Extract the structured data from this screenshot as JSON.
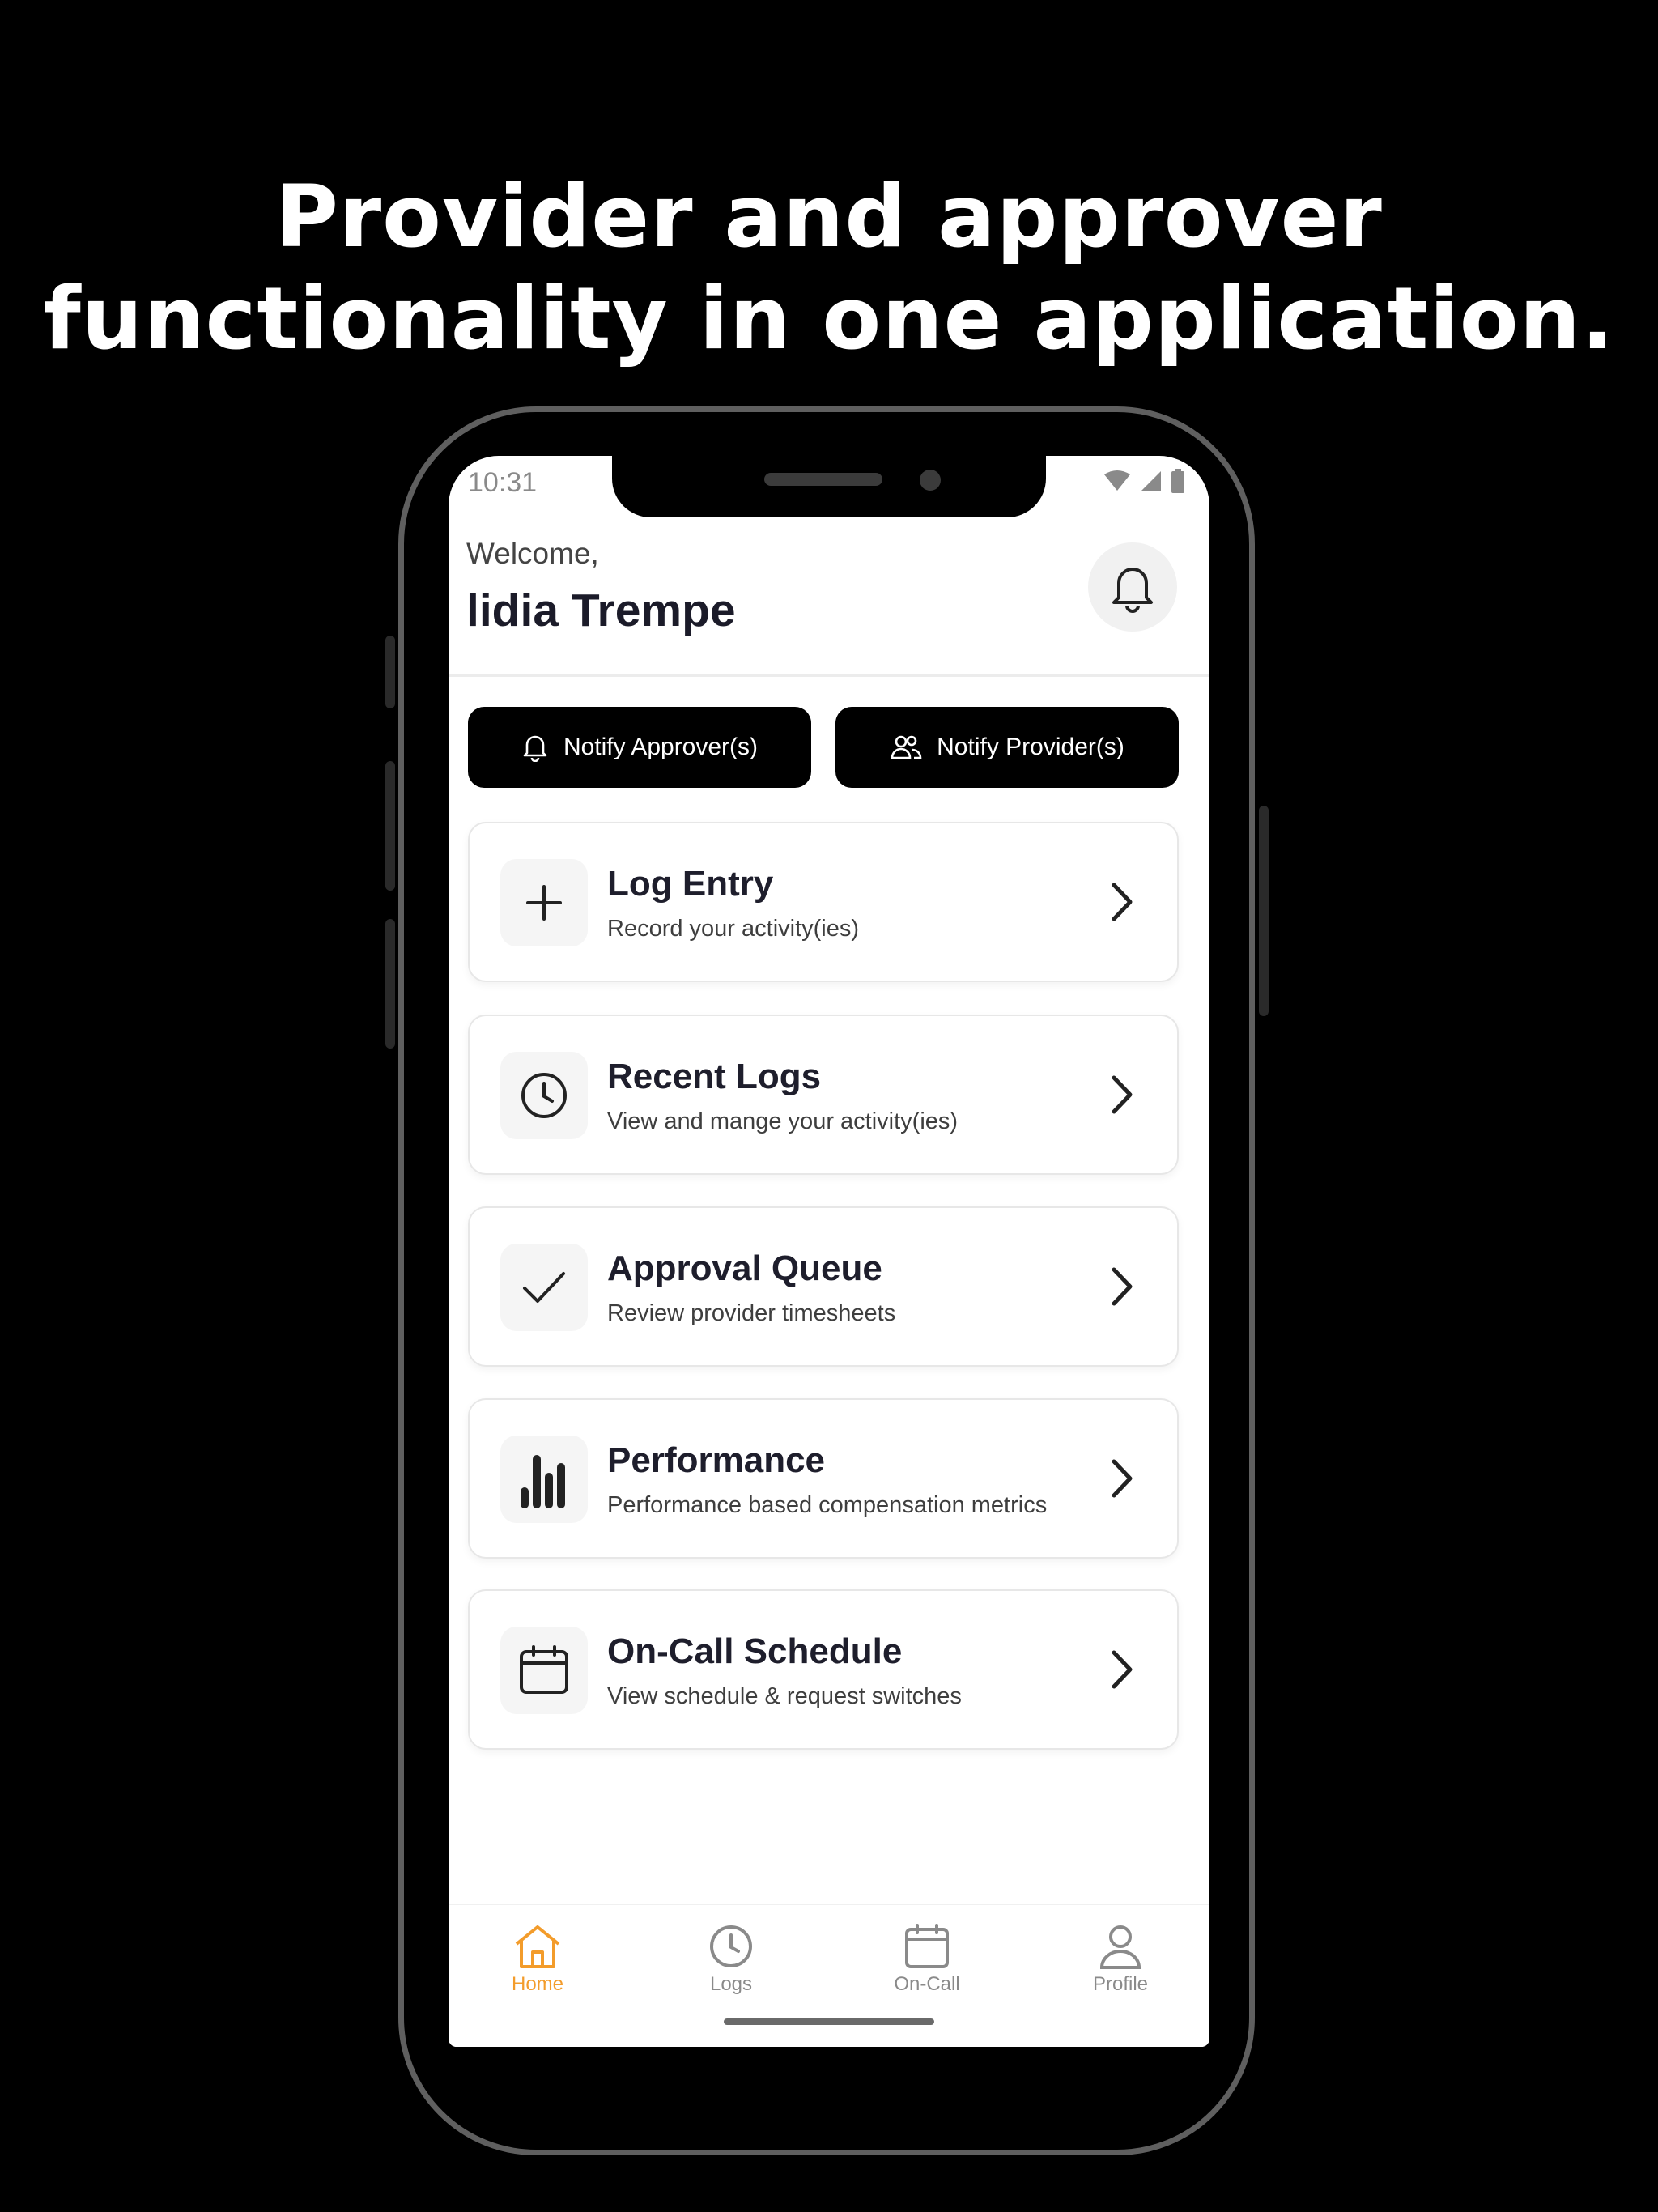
{
  "headline": {
    "line1": "Provider and approver",
    "line2": "functionality in one application."
  },
  "status_bar": {
    "time": "10:31",
    "icons": [
      "wifi-icon",
      "signal-icon",
      "battery-icon"
    ]
  },
  "header": {
    "greeting": "Welcome,",
    "user_name": "lidia Trempe",
    "bell_icon": "bell-icon"
  },
  "actions": [
    {
      "label": "Notify Approver(s)",
      "icon": "bell-icon"
    },
    {
      "label": "Notify Provider(s)",
      "icon": "users-icon"
    }
  ],
  "menu": [
    {
      "title": "Log Entry",
      "subtitle": "Record your activity(ies)",
      "icon": "plus-icon"
    },
    {
      "title": "Recent Logs",
      "subtitle": "View and mange your activity(ies)",
      "icon": "clock-icon"
    },
    {
      "title": "Approval Queue",
      "subtitle": "Review provider timesheets",
      "icon": "check-icon"
    },
    {
      "title": "Performance",
      "subtitle": "Performance based compensation metrics",
      "icon": "bar-chart-icon"
    },
    {
      "title": "On-Call Schedule",
      "subtitle": "View schedule & request switches",
      "icon": "calendar-icon"
    }
  ],
  "tabs": [
    {
      "label": "Home",
      "icon": "home-icon",
      "active": true
    },
    {
      "label": "Logs",
      "icon": "clock-icon",
      "active": false
    },
    {
      "label": "On-Call",
      "icon": "calendar-icon",
      "active": false
    },
    {
      "label": "Profile",
      "icon": "user-icon",
      "active": false
    }
  ],
  "colors": {
    "background": "#000000",
    "accent": "#f39c2b",
    "inactive_tab": "#8a8a8a",
    "button": "#000000"
  }
}
